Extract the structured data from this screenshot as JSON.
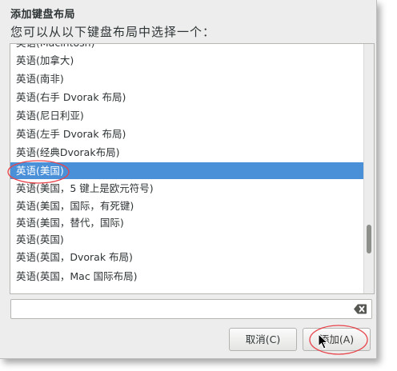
{
  "dialog": {
    "title": "添加键盘布局",
    "subtitle": "您可以从以下键盘布局中选择一个："
  },
  "layouts": [
    {
      "label": "英语(Macintosh)",
      "selected": false
    },
    {
      "label": "英语(加拿大)",
      "selected": false
    },
    {
      "label": "英语(南非)",
      "selected": false
    },
    {
      "label": "英语(右手 Dvorak 布局)",
      "selected": false
    },
    {
      "label": "英语(尼日利亚)",
      "selected": false
    },
    {
      "label": "英语(左手 Dvorak 布局)",
      "selected": false
    },
    {
      "label": "英语(经典Dvorak布局)",
      "selected": false
    },
    {
      "label": "英语(美国)",
      "selected": true
    },
    {
      "label": "英语(美国，5 键上是欧元符号)",
      "selected": false
    },
    {
      "label": "英语(美国，国际，有死键)",
      "selected": false
    },
    {
      "label": "英语(美国，替代，国际)",
      "selected": false
    },
    {
      "label": "英语(英国)",
      "selected": false
    },
    {
      "label": "英语(英国，Dvorak 布局)",
      "selected": false
    },
    {
      "label": "英语(英国，Mac 国际布局)",
      "selected": false
    }
  ],
  "search": {
    "value": "",
    "placeholder": ""
  },
  "buttons": {
    "cancel_label": "取消(C)",
    "add_label": "添加(A)"
  },
  "colors": {
    "selection": "#4a90d9",
    "annotation": "#e8434a"
  },
  "icons": {
    "clear": "backspace-clear-icon"
  }
}
